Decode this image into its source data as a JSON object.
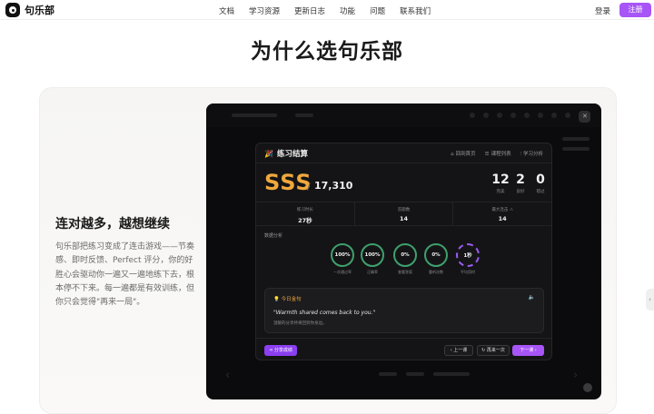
{
  "nav": {
    "logo_text": "句乐部",
    "menu": [
      "文档",
      "学习资源",
      "更新日志",
      "功能",
      "问题",
      "联系我们"
    ],
    "login": "登录",
    "signup": "注册",
    "accent": "#a855f7"
  },
  "hero": {
    "title": "为什么选句乐部"
  },
  "feature": {
    "title": "连对越多，越想继续",
    "description": "句乐部把练习变成了连击游戏——节奏感、即时反馈、Perfect 评分，你的好胜心会驱动你一遍又一遍地练下去，根本停不下来。每一遍都是有效训练，但你只会觉得\"再来一局\"。"
  },
  "modal": {
    "title": "练习结算",
    "title_icon": "party-popper-icon",
    "links": [
      {
        "icon": "home-icon",
        "glyph": "⌂",
        "label": "回到首页"
      },
      {
        "icon": "list-icon",
        "glyph": "☰",
        "label": "课程列表"
      },
      {
        "icon": "chart-icon",
        "glyph": "⫶",
        "label": "学习分析"
      }
    ],
    "grade": "SSS",
    "score_sep": "/",
    "score": "17,310",
    "tallies": [
      {
        "value": "12",
        "label": "完美"
      },
      {
        "value": "2",
        "label": "良好"
      },
      {
        "value": "0",
        "label": "错过"
      }
    ],
    "stats": [
      {
        "label": "练习时长",
        "value": "27秒"
      },
      {
        "label": "答题数",
        "value": "14"
      },
      {
        "label": "最大连击 ⚠",
        "value": "14"
      }
    ],
    "section_label": "数据分析",
    "rings": [
      {
        "value": "100%",
        "label": "一次通过率",
        "style": "green"
      },
      {
        "value": "100%",
        "label": "正确率",
        "style": "green"
      },
      {
        "value": "0%",
        "label": "查看答案",
        "style": "green"
      },
      {
        "value": "0%",
        "label": "重听次数",
        "style": "green"
      },
      {
        "value": "1秒",
        "label": "平均用时",
        "style": "purple"
      }
    ],
    "quote": {
      "tag": "今日金句",
      "english": "\"Warmth shared comes back to you.\"",
      "chinese": "温暖的分享终将回到你身边。"
    },
    "footer": {
      "share": "分享成绩",
      "prev": "‹ 上一课",
      "again": "↻ 再来一次",
      "next": "下一课 ›"
    }
  }
}
